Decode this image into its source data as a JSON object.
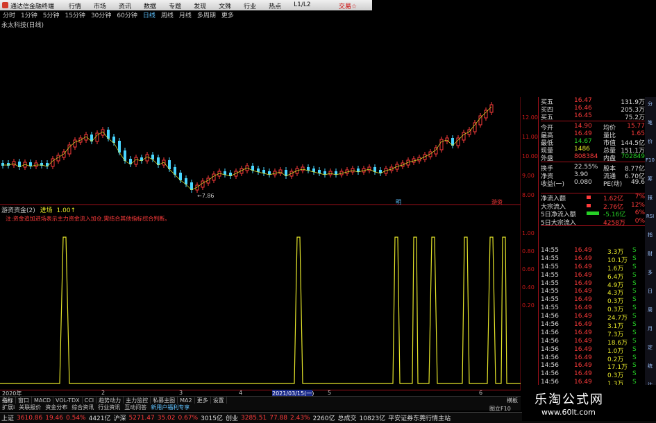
{
  "window": {
    "title": "通达信金融终端",
    "menu": [
      "行情",
      "市场",
      "资讯",
      "数据",
      "专题",
      "发现",
      "文殊",
      "行业",
      "热点",
      "L1/L2"
    ],
    "right_link": "交易☆"
  },
  "toolbar": {
    "items": [
      "分时",
      "1分钟",
      "5分钟",
      "15分钟",
      "30分钟",
      "60分钟",
      "日线",
      "周线",
      "月线",
      "多周期",
      "更多"
    ],
    "active": "日线"
  },
  "stock_name": "永太科技(日线)",
  "main_chart": {
    "price_labels": [
      "12.00",
      "11.00",
      "10.00",
      "9.00",
      "8.00"
    ],
    "low_marker": "←7.86"
  },
  "indicator": {
    "name": "游资资金(2)",
    "label": "进场",
    "value": "1.00↑",
    "note": "注:资金追加进场表示主力资金流入加仓,需结合其他指标综合判断。",
    "axis": [
      "1.00",
      "0.80",
      "0.60",
      "0.40",
      "0.20"
    ],
    "mark1": "明",
    "mark2": "游资"
  },
  "datebar": {
    "year": "2020年",
    "cursor": "2021/03/15(一)",
    "ticks": [
      "2",
      "3",
      "4",
      "5",
      "6"
    ]
  },
  "bottom_tabs": [
    "指标",
    "窗口",
    "MACD",
    "VOL-TDX",
    "CCI",
    "趋势动力",
    "主力监控",
    "私募主图",
    "MA2",
    "更多",
    "设置"
  ],
  "bottom_tabs2": [
    "扩展ⅰ",
    "关联报价",
    "资金分布",
    "综合资讯",
    "行业资讯",
    "互动问答",
    "新用户福利专享"
  ],
  "tabs_right": [
    "图立F10",
    "横板"
  ],
  "quote": {
    "rows": [
      {
        "label": "买五",
        "price": "16.47",
        "vol": "131.9万"
      },
      {
        "label": "买四",
        "price": "16.46",
        "vol": "205.3万"
      },
      {
        "label": "买五",
        "price": "16.45",
        "vol": "75.2万"
      },
      {
        "label": "今开",
        "price": "14.90",
        "k2": "均价",
        "v2": "15.77"
      },
      {
        "label": "最高",
        "price": "16.49",
        "k2": "量比",
        "v2": "1.65"
      },
      {
        "label": "最低",
        "price": "14.67",
        "k2": "市值",
        "v2": "144.5亿"
      },
      {
        "label": "现量",
        "price": "1486",
        "k2": "总量",
        "v2": "151.1万"
      },
      {
        "label": "外盘",
        "price": "808384",
        "k2": "内盘",
        "v2": "702849"
      },
      {
        "label": "换手",
        "price": "22.55%",
        "k2": "股本",
        "v2": "8.77亿"
      },
      {
        "label": "净资",
        "price": "3.90",
        "k2": "流通",
        "v2": "6.70亿"
      },
      {
        "label": "收益(一)",
        "price": "0.080",
        "k2": "PE(动)",
        "v2": "49.6"
      }
    ]
  },
  "flow": [
    {
      "label": "净流入额",
      "bar": "red",
      "val": "1.62亿",
      "pct": "7%"
    },
    {
      "label": "大宗流入",
      "bar": "red",
      "val": "2.76亿",
      "pct": "12%"
    },
    {
      "label": "5日净流入额",
      "bar": "green",
      "val": "-5.16亿",
      "pct": "6%"
    },
    {
      "label": "5日大宗流入",
      "bar": "",
      "val": "4258万",
      "pct": "0%"
    }
  ],
  "ticks": [
    {
      "t": "14:55",
      "p": "16.49",
      "v": "3.3万",
      "d": "S"
    },
    {
      "t": "14:55",
      "p": "16.49",
      "v": "10.1万",
      "d": "S"
    },
    {
      "t": "14:55",
      "p": "16.49",
      "v": "1.6万",
      "d": "S"
    },
    {
      "t": "14:55",
      "p": "16.49",
      "v": "6.4万",
      "d": "S"
    },
    {
      "t": "14:55",
      "p": "16.49",
      "v": "4.9万",
      "d": "S"
    },
    {
      "t": "14:55",
      "p": "16.49",
      "v": "4.3万",
      "d": "S"
    },
    {
      "t": "14:55",
      "p": "16.49",
      "v": "0.3万",
      "d": "S"
    },
    {
      "t": "14:55",
      "p": "16.49",
      "v": "0.3万",
      "d": "S"
    },
    {
      "t": "14:56",
      "p": "16.49",
      "v": "24.7万",
      "d": "S"
    },
    {
      "t": "14:56",
      "p": "16.49",
      "v": "3.1万",
      "d": "S"
    },
    {
      "t": "14:56",
      "p": "16.49",
      "v": "7.3万",
      "d": "S"
    },
    {
      "t": "14:56",
      "p": "16.49",
      "v": "18.6万",
      "d": "S"
    },
    {
      "t": "14:56",
      "p": "16.49",
      "v": "1.0万",
      "d": "S"
    },
    {
      "t": "14:56",
      "p": "16.49",
      "v": "0.2万",
      "d": "S"
    },
    {
      "t": "14:56",
      "p": "16.49",
      "v": "17.1万",
      "d": "S"
    },
    {
      "t": "14:56",
      "p": "16.49",
      "v": "0.3万",
      "d": "S"
    },
    {
      "t": "14:56",
      "p": "16.49",
      "v": "1.3万",
      "d": "S"
    },
    {
      "t": "14:56",
      "p": "16.49",
      "v": "25.6万",
      "d": "S"
    },
    {
      "t": "14:56",
      "p": "16.49",
      "v": "1.0万",
      "d": "S"
    }
  ],
  "sidebar": [
    "分",
    "笔",
    "价",
    "F10",
    "筹",
    "报",
    "RSI",
    "指",
    "财",
    "多",
    "日",
    "周",
    "月",
    "定",
    "统",
    "计"
  ],
  "status": [
    {
      "t": "上证",
      "c": "white"
    },
    {
      "t": "3610.86",
      "c": "red"
    },
    {
      "t": "19.46",
      "c": "red"
    },
    {
      "t": "0.54%",
      "c": "red"
    },
    {
      "t": "4421亿",
      "c": "white"
    },
    {
      "t": "沪深",
      "c": "white"
    },
    {
      "t": "5271.47",
      "c": "red"
    },
    {
      "t": "35.02",
      "c": "red"
    },
    {
      "t": "0.67%",
      "c": "red"
    },
    {
      "t": "3015亿",
      "c": "white"
    },
    {
      "t": "创业",
      "c": "white"
    },
    {
      "t": "3285.51",
      "c": "red"
    },
    {
      "t": "77.88",
      "c": "red"
    },
    {
      "t": "2.43%",
      "c": "red"
    },
    {
      "t": "2260亿",
      "c": "white"
    },
    {
      "t": "总成交",
      "c": "white"
    },
    {
      "t": "10823亿",
      "c": "white"
    },
    {
      "t": "平安证券东莞行情主站",
      "c": "white"
    }
  ],
  "watermark": {
    "line1": "乐淘公式网",
    "line2": "www.60lt.com"
  },
  "colors": {
    "up": "#ff3b3b",
    "down": "#49d6ff",
    "indicator": "#e6e62a",
    "axis": "#a0101a"
  }
}
